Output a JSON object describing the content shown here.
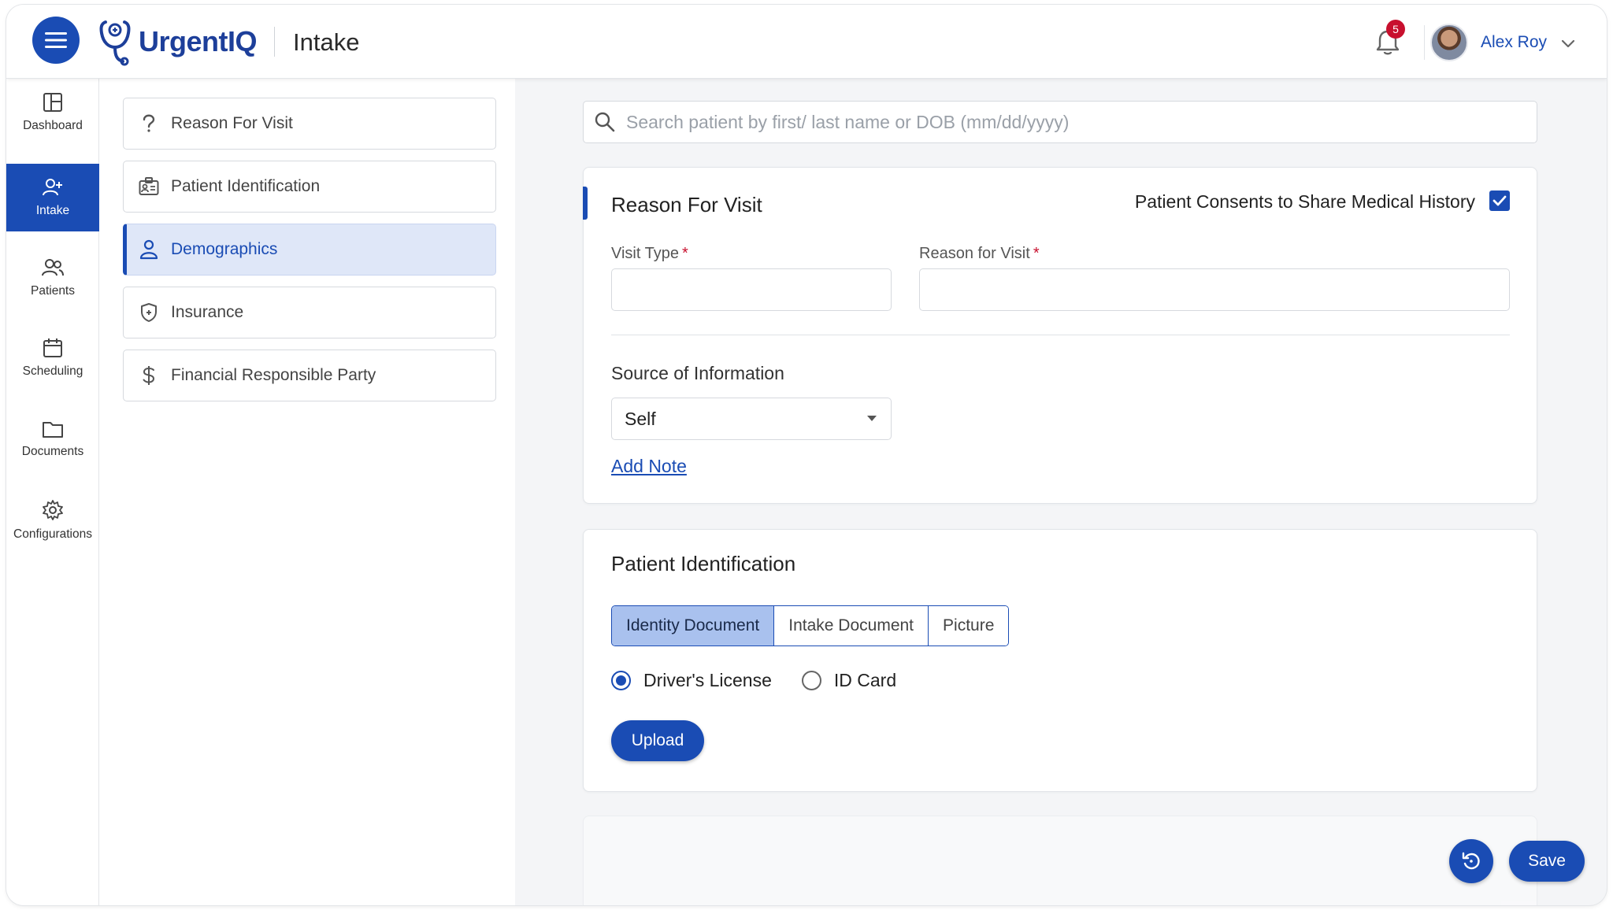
{
  "header": {
    "logo_text": "UrgentIQ",
    "page_title": "Intake",
    "notification_count": "5",
    "user_name": "Alex Roy"
  },
  "rail": {
    "items": [
      {
        "label": "Dashboard",
        "icon": "dashboard-icon"
      },
      {
        "label": "Intake",
        "icon": "add-user-icon",
        "active": true
      },
      {
        "label": "Patients",
        "icon": "users-icon"
      },
      {
        "label": "Scheduling",
        "icon": "calendar-icon"
      },
      {
        "label": "Documents",
        "icon": "folder-icon"
      },
      {
        "label": "Configurations",
        "icon": "gear-icon"
      }
    ]
  },
  "sections": {
    "items": [
      {
        "label": "Reason For Visit",
        "icon": "question-icon"
      },
      {
        "label": "Patient Identification",
        "icon": "id-card-icon"
      },
      {
        "label": "Demographics",
        "icon": "person-icon",
        "active": true
      },
      {
        "label": "Insurance",
        "icon": "shield-icon"
      },
      {
        "label": "Financial Responsible Party",
        "icon": "dollar-icon"
      }
    ]
  },
  "search": {
    "placeholder": "Search patient by first/ last name or DOB (mm/dd/yyyy)"
  },
  "reason_card": {
    "title": "Reason For Visit",
    "consent_label": "Patient Consents to Share Medical History",
    "consent_checked": true,
    "visit_type_label": "Visit Type",
    "visit_type_value": "",
    "reason_label": "Reason for Visit",
    "reason_value": "",
    "required_mark": "*",
    "source_label": "Source of Information",
    "source_value": "Self",
    "add_note": "Add Note"
  },
  "identification_card": {
    "title": "Patient Identification",
    "tabs": [
      "Identity Document",
      "Intake Document",
      "Picture"
    ],
    "active_tab": "Identity Document",
    "radio_options": [
      "Driver's License",
      "ID Card"
    ],
    "selected_radio": "Driver's License",
    "upload_label": "Upload"
  },
  "actions": {
    "save_label": "Save"
  },
  "colors": {
    "primary": "#1a4cb4",
    "badge": "#c8102e",
    "active_nav_bg": "#dfe7f8",
    "active_tab_bg": "#a9c1ee"
  }
}
